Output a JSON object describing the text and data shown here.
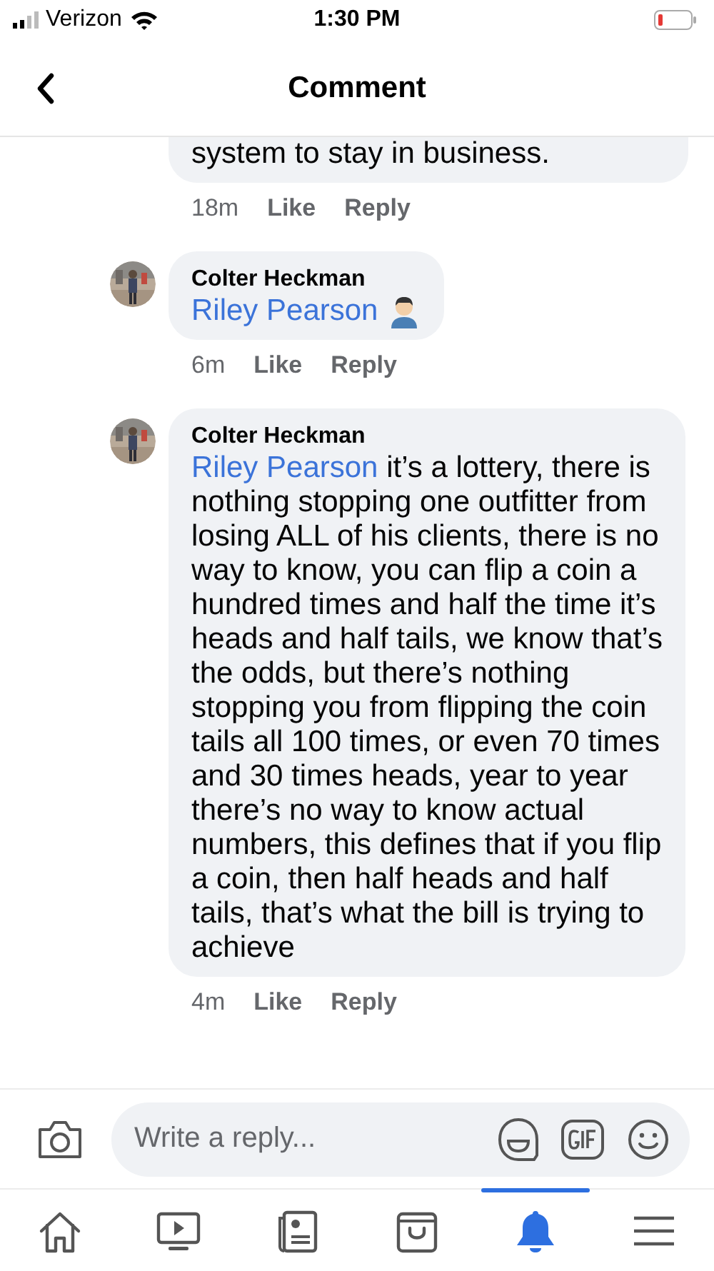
{
  "status_bar": {
    "carrier": "Verizon",
    "time": "1:30 PM"
  },
  "header": {
    "title": "Comment"
  },
  "comments": [
    {
      "text": "system to stay in business.",
      "time": "18m",
      "actions": [
        "Like",
        "Reply"
      ]
    },
    {
      "avatar": {
        "kind": "picture"
      },
      "author": "Colter Heckman",
      "mention": "Riley Pearson",
      "trailing_icon": {
        "kind": "person"
      },
      "time": "6m",
      "actions": [
        "Like",
        "Reply"
      ]
    },
    {
      "avatar": {
        "kind": "picture"
      },
      "author": "Colter Heckman",
      "mention": "Riley Pearson",
      "text": "it’s a lottery, there is nothing stopping one outfitter from losing ALL of his clients, there is no way to know, you can flip a coin a hundred times and half the time it’s heads and half tails, we know that’s the odds, but there’s nothing stopping you from flipping the coin tails all 100 times, or even 70 times and 30 times heads, year to year there’s no way to know actual numbers, this defines that if you flip a coin, then half heads and half tails, that’s what the bill is trying to achieve",
      "time": "4m",
      "actions": [
        "Like",
        "Reply"
      ]
    }
  ],
  "composer": {
    "placeholder": "Write a reply..."
  },
  "nav": [
    {
      "kind": "home",
      "selected": false
    },
    {
      "kind": "video",
      "selected": false
    },
    {
      "kind": "news",
      "selected": false
    },
    {
      "kind": "shop",
      "selected": false
    },
    {
      "kind": "bell",
      "selected": true
    },
    {
      "kind": "menu",
      "selected": false
    }
  ]
}
